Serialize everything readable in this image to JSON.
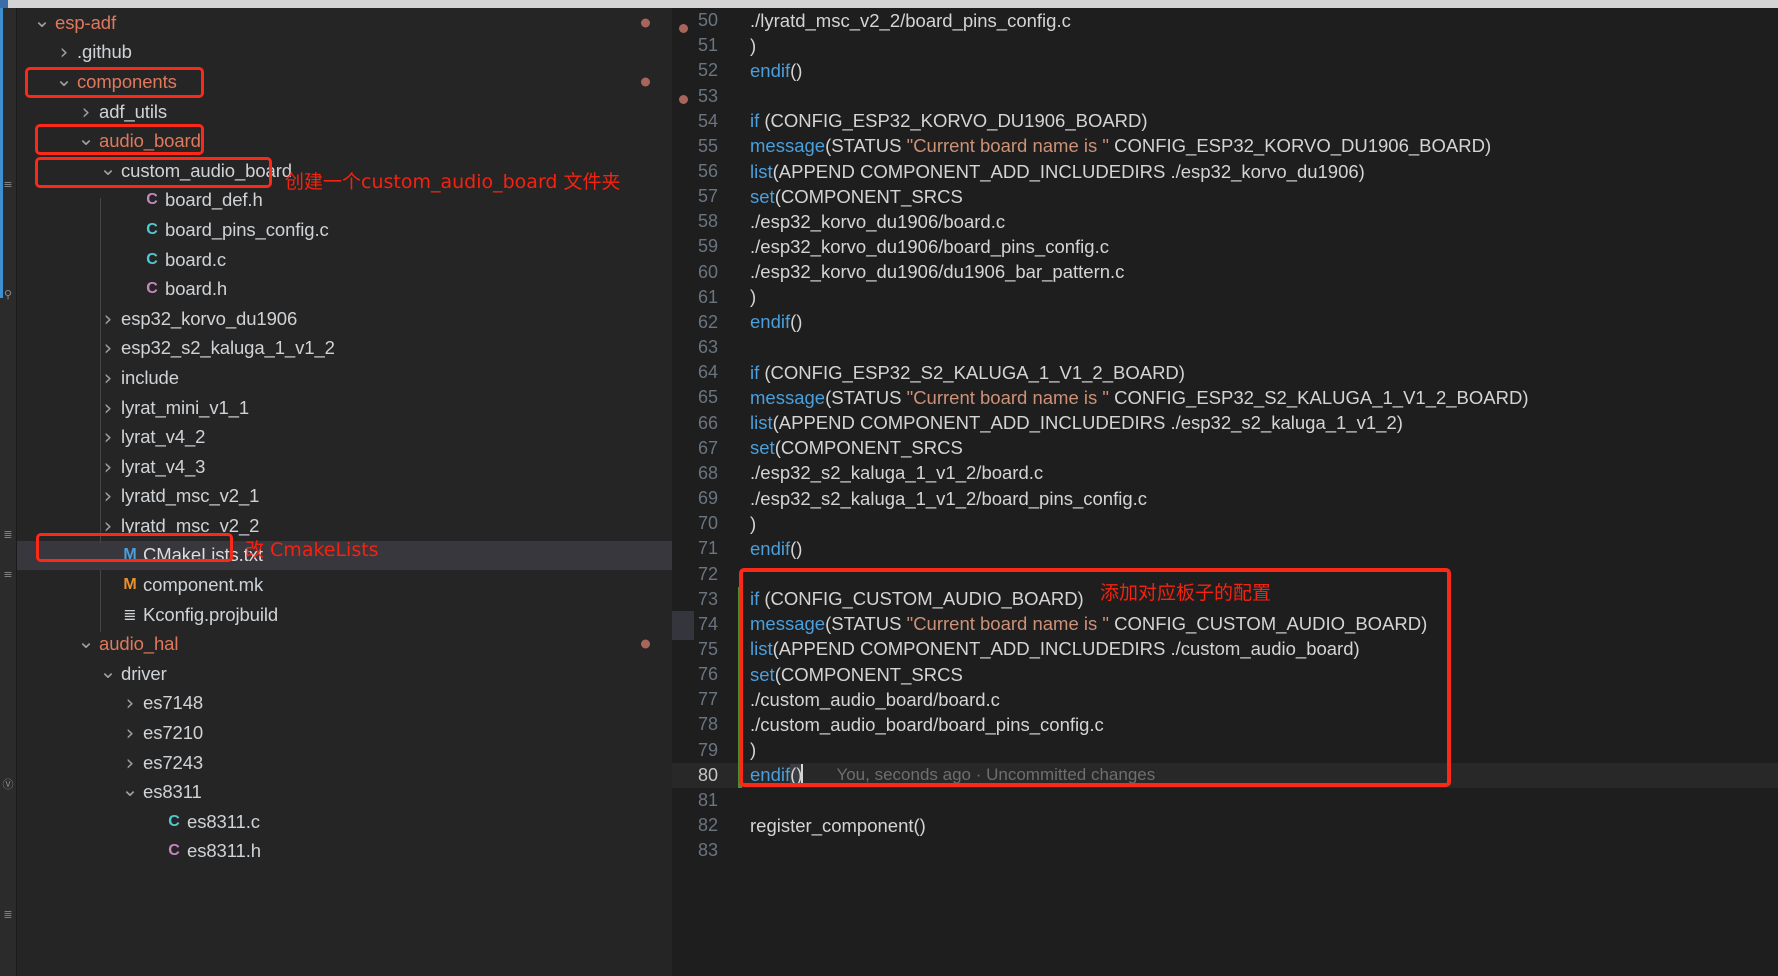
{
  "window": {
    "accent_red": "#fb2a18",
    "editor_bg": "#1e1e1e",
    "sidebar_bg": "#252526"
  },
  "rail": {
    "glyphs": [
      "≡",
      "⌘",
      "≣",
      "≡",
      "Ⓕ"
    ]
  },
  "sidebar": {
    "items": [
      {
        "indent": 0,
        "twisty": "chevron-down",
        "icon": "",
        "icon_color": "",
        "label": "esp-adf",
        "label_color": "#e0795c",
        "modified_dot": true,
        "selected": false,
        "name": "tree-item-esp-adf"
      },
      {
        "indent": 1,
        "twisty": "chevron-right",
        "icon": "",
        "icon_color": "",
        "label": ".github",
        "label_color": "#cfd3d6",
        "modified_dot": false,
        "selected": false,
        "name": "tree-item-github"
      },
      {
        "indent": 1,
        "twisty": "chevron-down",
        "icon": "",
        "icon_color": "",
        "label": "components",
        "label_color": "#e0795c",
        "modified_dot": true,
        "selected": false,
        "name": "tree-item-components"
      },
      {
        "indent": 2,
        "twisty": "chevron-right",
        "icon": "",
        "icon_color": "",
        "label": "adf_utils",
        "label_color": "#cfd3d6",
        "modified_dot": false,
        "selected": false,
        "name": "tree-item-adf-utils"
      },
      {
        "indent": 2,
        "twisty": "chevron-down",
        "icon": "",
        "icon_color": "",
        "label": "audio_board",
        "label_color": "#e0795c",
        "modified_dot": false,
        "selected": false,
        "name": "tree-item-audio-board"
      },
      {
        "indent": 3,
        "twisty": "chevron-down",
        "icon": "",
        "icon_color": "",
        "label": "custom_audio_board",
        "label_color": "#cfd3d6",
        "modified_dot": false,
        "selected": false,
        "name": "tree-item-custom-audio-board"
      },
      {
        "indent": 4,
        "twisty": "",
        "icon": "C",
        "icon_color": "#c586c0",
        "label": "board_def.h",
        "label_color": "#cfd3d6",
        "modified_dot": false,
        "selected": false,
        "name": "tree-item-board-def-h"
      },
      {
        "indent": 4,
        "twisty": "",
        "icon": "C",
        "icon_color": "#4ec9d3",
        "label": "board_pins_config.c",
        "label_color": "#cfd3d6",
        "modified_dot": false,
        "selected": false,
        "name": "tree-item-board-pins-config-c"
      },
      {
        "indent": 4,
        "twisty": "",
        "icon": "C",
        "icon_color": "#4ec9d3",
        "label": "board.c",
        "label_color": "#cfd3d6",
        "modified_dot": false,
        "selected": false,
        "name": "tree-item-board-c"
      },
      {
        "indent": 4,
        "twisty": "",
        "icon": "C",
        "icon_color": "#c586c0",
        "label": "board.h",
        "label_color": "#cfd3d6",
        "modified_dot": false,
        "selected": false,
        "name": "tree-item-board-h"
      },
      {
        "indent": 3,
        "twisty": "chevron-right",
        "icon": "",
        "icon_color": "",
        "label": "esp32_korvo_du1906",
        "label_color": "#cfd3d6",
        "modified_dot": false,
        "selected": false,
        "name": "tree-item-esp32-korvo-du1906"
      },
      {
        "indent": 3,
        "twisty": "chevron-right",
        "icon": "",
        "icon_color": "",
        "label": "esp32_s2_kaluga_1_v1_2",
        "label_color": "#cfd3d6",
        "modified_dot": false,
        "selected": false,
        "name": "tree-item-esp32-s2-kaluga"
      },
      {
        "indent": 3,
        "twisty": "chevron-right",
        "icon": "",
        "icon_color": "",
        "label": "include",
        "label_color": "#cfd3d6",
        "modified_dot": false,
        "selected": false,
        "name": "tree-item-include"
      },
      {
        "indent": 3,
        "twisty": "chevron-right",
        "icon": "",
        "icon_color": "",
        "label": "lyrat_mini_v1_1",
        "label_color": "#cfd3d6",
        "modified_dot": false,
        "selected": false,
        "name": "tree-item-lyrat-mini-v1-1"
      },
      {
        "indent": 3,
        "twisty": "chevron-right",
        "icon": "",
        "icon_color": "",
        "label": "lyrat_v4_2",
        "label_color": "#cfd3d6",
        "modified_dot": false,
        "selected": false,
        "name": "tree-item-lyrat-v4-2"
      },
      {
        "indent": 3,
        "twisty": "chevron-right",
        "icon": "",
        "icon_color": "",
        "label": "lyrat_v4_3",
        "label_color": "#cfd3d6",
        "modified_dot": false,
        "selected": false,
        "name": "tree-item-lyrat-v4-3"
      },
      {
        "indent": 3,
        "twisty": "chevron-right",
        "icon": "",
        "icon_color": "",
        "label": "lyratd_msc_v2_1",
        "label_color": "#cfd3d6",
        "modified_dot": false,
        "selected": false,
        "name": "tree-item-lyratd-msc-v2-1"
      },
      {
        "indent": 3,
        "twisty": "chevron-right",
        "icon": "",
        "icon_color": "",
        "label": "lyratd_msc_v2_2",
        "label_color": "#cfd3d6",
        "modified_dot": false,
        "selected": false,
        "name": "tree-item-lyratd-msc-v2-2"
      },
      {
        "indent": 3,
        "twisty": "",
        "icon": "M",
        "icon_color": "#4a9fdc",
        "label": "CMakeLists.txt",
        "label_color": "#dcdcdc",
        "modified_dot": false,
        "selected": true,
        "name": "tree-item-cmakelists-txt"
      },
      {
        "indent": 3,
        "twisty": "",
        "icon": "M",
        "icon_color": "#e8912d",
        "label": "component.mk",
        "label_color": "#cfd3d6",
        "modified_dot": false,
        "selected": false,
        "name": "tree-item-component-mk"
      },
      {
        "indent": 3,
        "twisty": "",
        "icon": "≣",
        "icon_color": "#cfd3d6",
        "label": "Kconfig.projbuild",
        "label_color": "#cfd3d6",
        "modified_dot": false,
        "selected": false,
        "name": "tree-item-kconfig-projbuild"
      },
      {
        "indent": 2,
        "twisty": "chevron-down",
        "icon": "",
        "icon_color": "",
        "label": "audio_hal",
        "label_color": "#e0795c",
        "modified_dot": true,
        "selected": false,
        "name": "tree-item-audio-hal"
      },
      {
        "indent": 3,
        "twisty": "chevron-down",
        "icon": "",
        "icon_color": "",
        "label": "driver",
        "label_color": "#cfd3d6",
        "modified_dot": false,
        "selected": false,
        "name": "tree-item-driver"
      },
      {
        "indent": 4,
        "twisty": "chevron-right",
        "icon": "",
        "icon_color": "",
        "label": "es7148",
        "label_color": "#cfd3d6",
        "modified_dot": false,
        "selected": false,
        "name": "tree-item-es7148"
      },
      {
        "indent": 4,
        "twisty": "chevron-right",
        "icon": "",
        "icon_color": "",
        "label": "es7210",
        "label_color": "#cfd3d6",
        "modified_dot": false,
        "selected": false,
        "name": "tree-item-es7210"
      },
      {
        "indent": 4,
        "twisty": "chevron-right",
        "icon": "",
        "icon_color": "",
        "label": "es7243",
        "label_color": "#cfd3d6",
        "modified_dot": false,
        "selected": false,
        "name": "tree-item-es7243"
      },
      {
        "indent": 4,
        "twisty": "chevron-down",
        "icon": "",
        "icon_color": "",
        "label": "es8311",
        "label_color": "#cfd3d6",
        "modified_dot": false,
        "selected": false,
        "name": "tree-item-es8311"
      },
      {
        "indent": 5,
        "twisty": "",
        "icon": "C",
        "icon_color": "#4ec9d3",
        "label": "es8311.c",
        "label_color": "#cfd3d6",
        "modified_dot": false,
        "selected": false,
        "name": "tree-item-es8311-c"
      },
      {
        "indent": 5,
        "twisty": "",
        "icon": "C",
        "icon_color": "#c586c0",
        "label": "es8311.h",
        "label_color": "#cfd3d6",
        "modified_dot": false,
        "selected": false,
        "name": "tree-item-es8311-h"
      }
    ]
  },
  "annotations": [
    {
      "text": "创建一个custom_audio_board 文件夹",
      "name": "annotation-create-folder"
    },
    {
      "text": "改 CmakeLists",
      "name": "annotation-edit-cmakelists"
    },
    {
      "text": "添加对应板子的配置",
      "name": "annotation-add-board-config"
    }
  ],
  "editor": {
    "first_line_number": 50,
    "active_line_number": 80,
    "blame_text": "You, seconds ago · Uncommitted changes",
    "breakpoint_dot_lines": [
      50,
      53
    ],
    "git_added_lines": [
      73,
      74,
      75,
      76,
      77,
      78,
      79,
      80
    ],
    "lines": [
      {
        "n": 50,
        "tokens": [
          {
            "t": "plain",
            "v": "./lyratd_msc_v2_2/board_pins_config.c"
          }
        ]
      },
      {
        "n": 51,
        "tokens": [
          {
            "t": "plain",
            "v": ")"
          }
        ]
      },
      {
        "n": 52,
        "tokens": [
          {
            "t": "kw",
            "v": "endif"
          },
          {
            "t": "plain",
            "v": "()"
          }
        ]
      },
      {
        "n": 53,
        "tokens": [
          {
            "t": "plain",
            "v": ""
          }
        ]
      },
      {
        "n": 54,
        "tokens": [
          {
            "t": "kw",
            "v": "if"
          },
          {
            "t": "plain",
            "v": " (CONFIG_ESP32_KORVO_DU1906_BOARD)"
          }
        ]
      },
      {
        "n": 55,
        "tokens": [
          {
            "t": "kw",
            "v": "message"
          },
          {
            "t": "plain",
            "v": "(STATUS "
          },
          {
            "t": "str",
            "v": "\"Current board name is \""
          },
          {
            "t": "plain",
            "v": " CONFIG_ESP32_KORVO_DU1906_BOARD)"
          }
        ]
      },
      {
        "n": 56,
        "tokens": [
          {
            "t": "kw",
            "v": "list"
          },
          {
            "t": "plain",
            "v": "(APPEND COMPONENT_ADD_INCLUDEDIRS ./esp32_korvo_du1906)"
          }
        ]
      },
      {
        "n": 57,
        "tokens": [
          {
            "t": "kw",
            "v": "set"
          },
          {
            "t": "plain",
            "v": "(COMPONENT_SRCS"
          }
        ]
      },
      {
        "n": 58,
        "tokens": [
          {
            "t": "plain",
            "v": "./esp32_korvo_du1906/board.c"
          }
        ]
      },
      {
        "n": 59,
        "tokens": [
          {
            "t": "plain",
            "v": "./esp32_korvo_du1906/board_pins_config.c"
          }
        ]
      },
      {
        "n": 60,
        "tokens": [
          {
            "t": "plain",
            "v": "./esp32_korvo_du1906/du1906_bar_pattern.c"
          }
        ]
      },
      {
        "n": 61,
        "tokens": [
          {
            "t": "plain",
            "v": ")"
          }
        ]
      },
      {
        "n": 62,
        "tokens": [
          {
            "t": "kw",
            "v": "endif"
          },
          {
            "t": "plain",
            "v": "()"
          }
        ]
      },
      {
        "n": 63,
        "tokens": [
          {
            "t": "plain",
            "v": ""
          }
        ]
      },
      {
        "n": 64,
        "tokens": [
          {
            "t": "kw",
            "v": "if"
          },
          {
            "t": "plain",
            "v": " (CONFIG_ESP32_S2_KALUGA_1_V1_2_BOARD)"
          }
        ]
      },
      {
        "n": 65,
        "tokens": [
          {
            "t": "kw",
            "v": "message"
          },
          {
            "t": "plain",
            "v": "(STATUS "
          },
          {
            "t": "str",
            "v": "\"Current board name is \""
          },
          {
            "t": "plain",
            "v": " CONFIG_ESP32_S2_KALUGA_1_V1_2_BOARD)"
          }
        ]
      },
      {
        "n": 66,
        "tokens": [
          {
            "t": "kw",
            "v": "list"
          },
          {
            "t": "plain",
            "v": "(APPEND COMPONENT_ADD_INCLUDEDIRS ./esp32_s2_kaluga_1_v1_2)"
          }
        ]
      },
      {
        "n": 67,
        "tokens": [
          {
            "t": "kw",
            "v": "set"
          },
          {
            "t": "plain",
            "v": "(COMPONENT_SRCS"
          }
        ]
      },
      {
        "n": 68,
        "tokens": [
          {
            "t": "plain",
            "v": "./esp32_s2_kaluga_1_v1_2/board.c"
          }
        ]
      },
      {
        "n": 69,
        "tokens": [
          {
            "t": "plain",
            "v": "./esp32_s2_kaluga_1_v1_2/board_pins_config.c"
          }
        ]
      },
      {
        "n": 70,
        "tokens": [
          {
            "t": "plain",
            "v": ")"
          }
        ]
      },
      {
        "n": 71,
        "tokens": [
          {
            "t": "kw",
            "v": "endif"
          },
          {
            "t": "plain",
            "v": "()"
          }
        ]
      },
      {
        "n": 72,
        "tokens": [
          {
            "t": "plain",
            "v": ""
          }
        ]
      },
      {
        "n": 73,
        "tokens": [
          {
            "t": "kw",
            "v": "if"
          },
          {
            "t": "plain",
            "v": " (CONFIG_CUSTOM_AUDIO_BOARD)"
          }
        ]
      },
      {
        "n": 74,
        "tokens": [
          {
            "t": "kw",
            "v": "message"
          },
          {
            "t": "plain",
            "v": "(STATUS "
          },
          {
            "t": "str",
            "v": "\"Current board name is \""
          },
          {
            "t": "plain",
            "v": " CONFIG_CUSTOM_AUDIO_BOARD)"
          }
        ]
      },
      {
        "n": 75,
        "tokens": [
          {
            "t": "kw",
            "v": "list"
          },
          {
            "t": "plain",
            "v": "(APPEND COMPONENT_ADD_INCLUDEDIRS ./custom_audio_board)"
          }
        ]
      },
      {
        "n": 76,
        "tokens": [
          {
            "t": "kw",
            "v": "set"
          },
          {
            "t": "plain",
            "v": "(COMPONENT_SRCS"
          }
        ]
      },
      {
        "n": 77,
        "tokens": [
          {
            "t": "plain",
            "v": "./custom_audio_board/board.c"
          }
        ]
      },
      {
        "n": 78,
        "tokens": [
          {
            "t": "plain",
            "v": "./custom_audio_board/board_pins_config.c"
          }
        ]
      },
      {
        "n": 79,
        "tokens": [
          {
            "t": "plain",
            "v": ")"
          }
        ]
      },
      {
        "n": 80,
        "tokens": [
          {
            "t": "kw",
            "v": "endif"
          },
          {
            "t": "sel",
            "v": "()"
          }
        ],
        "blame": true
      },
      {
        "n": 81,
        "tokens": [
          {
            "t": "plain",
            "v": ""
          }
        ]
      },
      {
        "n": 82,
        "tokens": [
          {
            "t": "plain",
            "v": "register_component()"
          }
        ]
      },
      {
        "n": 83,
        "tokens": [
          {
            "t": "plain",
            "v": ""
          }
        ]
      }
    ]
  }
}
